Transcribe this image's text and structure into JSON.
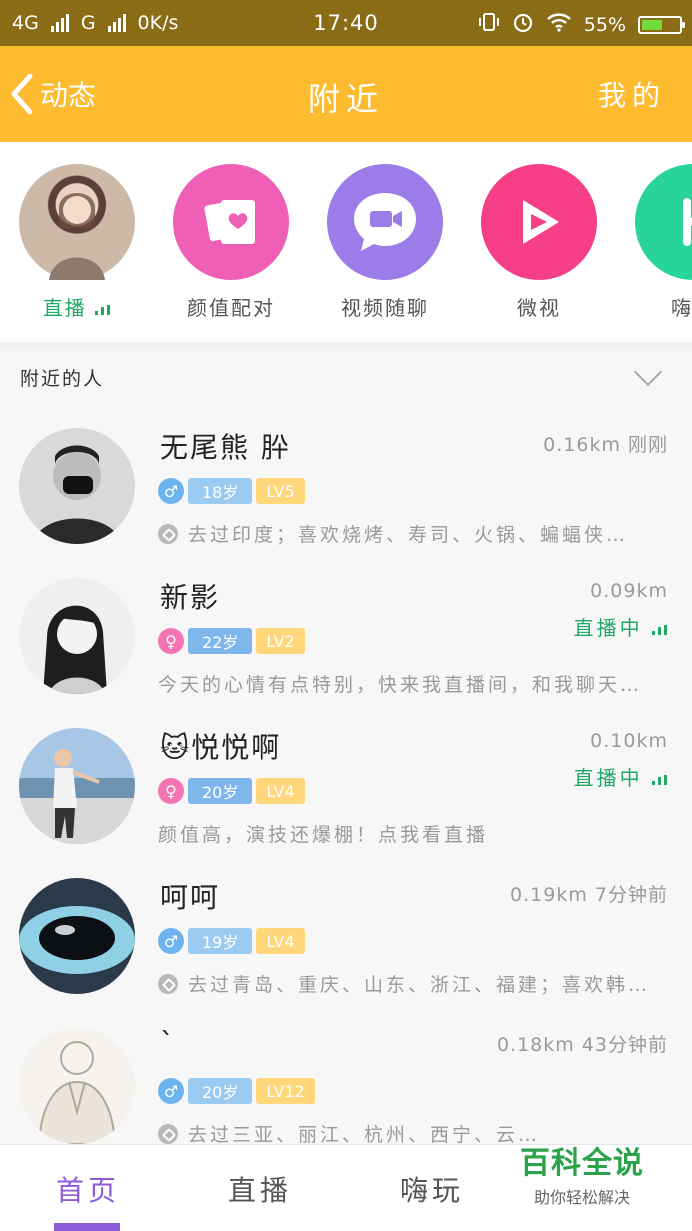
{
  "status_bar": {
    "network1": "4G",
    "network2": "G",
    "speed": "0K/s",
    "time": "17:40",
    "battery": "55%",
    "battery_level": 0.55
  },
  "header": {
    "back_label": "动态",
    "title": "附近",
    "right_label": "我的",
    "bg_color": "#fdbb2f"
  },
  "quick_entries": [
    {
      "label": "直播",
      "icon": "live-avatar",
      "color": "#d8c6b4"
    },
    {
      "label": "颜值配对",
      "icon": "card-heart-icon",
      "color": "#f05fb6"
    },
    {
      "label": "视频随聊",
      "icon": "video-chat-icon",
      "color": "#9b7ce8"
    },
    {
      "label": "微视",
      "icon": "play-icon",
      "color": "#f63f86"
    },
    {
      "label": "嗨玩",
      "icon": "game-icon",
      "color": "#28d49a"
    }
  ],
  "nearby": {
    "section_label": "附近的人",
    "people": [
      {
        "name": "无尾熊 肸",
        "distance": "0.16km 刚刚",
        "live": "",
        "gender": "male",
        "age": "18岁",
        "level": "LV5",
        "tagline": "去过印度；喜欢烧烤、寿司、火锅、蝙蝠侠…",
        "has_tag": true
      },
      {
        "name": "新影",
        "distance": "0.09km",
        "live": "直播中",
        "gender": "female",
        "age": "22岁",
        "level": "LV2",
        "tagline": "今天的心情有点特别，快来我直播间，和我聊天…",
        "has_tag": false
      },
      {
        "name": "🐱悦悦啊",
        "distance": "0.10km",
        "live": "直播中",
        "gender": "female",
        "age": "20岁",
        "level": "LV4",
        "tagline": "颜值高，演技还爆棚！点我看直播",
        "has_tag": false
      },
      {
        "name": "呵呵",
        "distance": "0.19km 7分钟前",
        "live": "",
        "gender": "male",
        "age": "19岁",
        "level": "LV4",
        "tagline": "去过青岛、重庆、山东、浙江、福建；喜欢韩…",
        "has_tag": true
      },
      {
        "name": "ˋ",
        "distance": "0.18km 43分钟前",
        "live": "",
        "gender": "male",
        "age": "20岁",
        "level": "LV12",
        "tagline": "去过三亚、丽江、杭州、西宁、云…",
        "has_tag": true
      }
    ]
  },
  "tabbar": {
    "tabs": [
      "首页",
      "直播",
      "嗨玩"
    ],
    "active_index": 0,
    "active_color": "#8b5bd9"
  },
  "watermark": {
    "big": "百科全说",
    "small": "助你轻松解决"
  }
}
